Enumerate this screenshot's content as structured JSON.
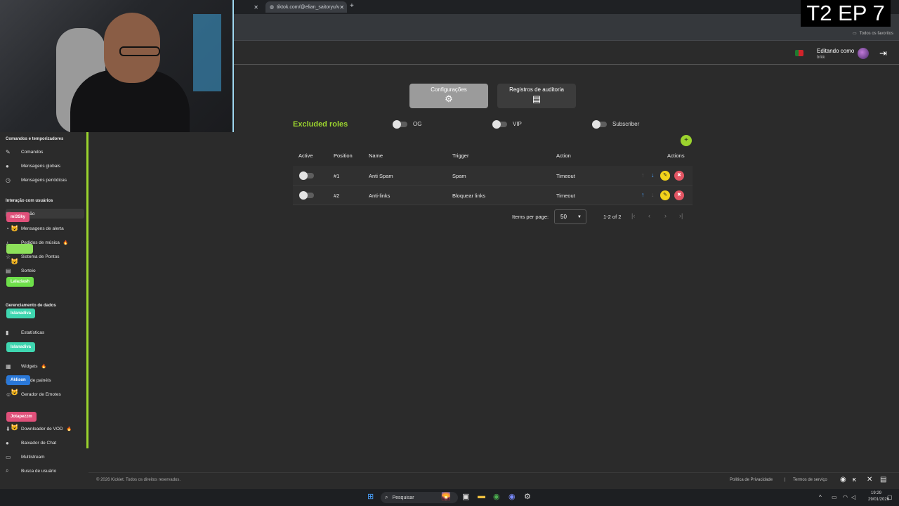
{
  "browser": {
    "tab_url": "tiktok.com/@elian_saitoryu/v",
    "favorites_label": "Todos os favoritos"
  },
  "overlay": {
    "episode": "T2 EP 7"
  },
  "header": {
    "editing_as": "Editando como",
    "username": "brkk"
  },
  "sidebar": {
    "sections": [
      "Comandos e temporizadores",
      "Interação com usuários",
      "Gerenciamento de dados"
    ],
    "items": [
      {
        "label": "Comandos",
        "icon": "wrench-icon"
      },
      {
        "label": "Mensagens globais",
        "icon": "chat-icon"
      },
      {
        "label": "Mensagens periódicas",
        "icon": "clock-icon"
      },
      {
        "label": "...ação",
        "icon": "shield-icon"
      },
      {
        "label": "Mensagens de alerta",
        "icon": "bell-icon"
      },
      {
        "label": "Pedidos de música",
        "icon": "music-icon",
        "badge": "🔥"
      },
      {
        "label": "Sistema de Pontos",
        "icon": "star-icon"
      },
      {
        "label": "Sorteio",
        "icon": "gift-icon"
      },
      {
        "label": "Estatísticas",
        "icon": "stats-icon"
      },
      {
        "label": "Widgets",
        "icon": "widget-icon",
        "badge": "🔥"
      },
      {
        "label": "...or de painéis",
        "icon": "panel-icon"
      },
      {
        "label": "Gerador de Emotes",
        "icon": "emote-icon"
      },
      {
        "label": "Downloader de VOD",
        "icon": "download-icon",
        "badge": "🔥"
      },
      {
        "label": "Baixador de Chat",
        "icon": "chat-download-icon"
      },
      {
        "label": "Multistream",
        "icon": "monitor-icon"
      },
      {
        "label": "Busca de usuário",
        "icon": "search-icon"
      }
    ],
    "chips": [
      {
        "label": "mi3Sky",
        "color": "#e0507a"
      },
      {
        "label": "",
        "color": "#8de05a"
      },
      {
        "label": "Lalaziash",
        "color": "#6ee04a"
      },
      {
        "label": "Islanadiva",
        "color": "#3fd6b0"
      },
      {
        "label": "Islanadiva",
        "color": "#3fd6b0"
      },
      {
        "label": "Aklison",
        "color": "#2a78d8"
      },
      {
        "label": "Jotapezzm",
        "color": "#e0507a"
      }
    ]
  },
  "main": {
    "btn_config": "Configurações",
    "btn_audit": "Registros de auditoria",
    "excluded_title": "Excluded roles",
    "roles": [
      "OG",
      "VIP",
      "Subscriber"
    ],
    "columns": [
      "Active",
      "Position",
      "Name",
      "Trigger",
      "Action",
      "Actions"
    ],
    "rows": [
      {
        "position": "#1",
        "name": "Anti Spam",
        "trigger": "Spam",
        "action": "Timeout"
      },
      {
        "position": "#2",
        "name": "Anti-links",
        "trigger": "Bloquear links",
        "action": "Timeout"
      }
    ],
    "items_per_page_label": "Items per page:",
    "items_per_page": "50",
    "range": "1-2 of 2"
  },
  "footer": {
    "copyright": "© 2026 Kickiet. Todos os direitos reservados.",
    "privacy": "Política de Privacidade",
    "separator": "|",
    "terms": "Termos de serviço"
  },
  "taskbar": {
    "search": "Pesquisar",
    "time": "19:29",
    "date": "29/01/2026"
  },
  "colors": {
    "accent": "#9bd32e",
    "edit": "#f2d21b",
    "delete": "#e25563"
  }
}
